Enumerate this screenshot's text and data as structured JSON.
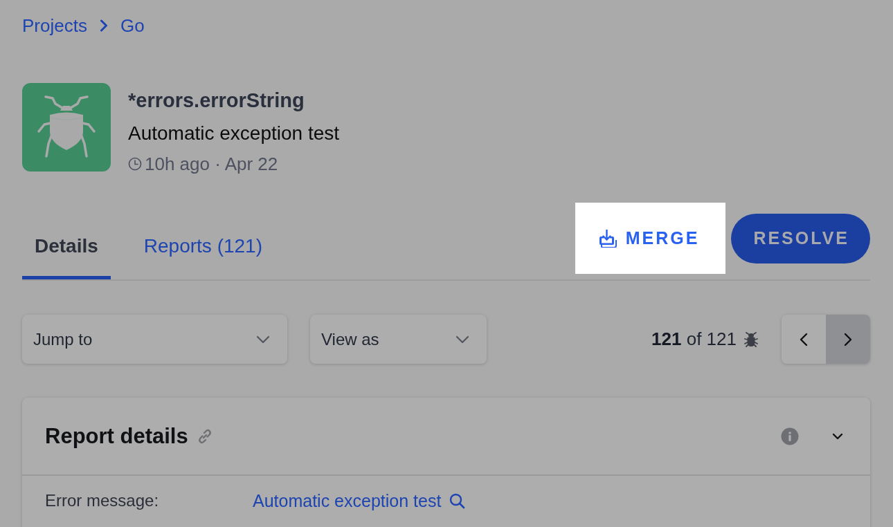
{
  "breadcrumb": [
    {
      "label": "Projects"
    },
    {
      "label": "Go"
    }
  ],
  "issue": {
    "title": "*errors.errorString",
    "message": "Automatic exception test",
    "time": "10h ago · Apr 22"
  },
  "tabs": [
    {
      "label": "Details",
      "selected": true
    },
    {
      "label": "Reports (121)",
      "selected": false
    }
  ],
  "actions": [
    {
      "kind": "merge",
      "label": "MERGE",
      "highlighted": true
    },
    {
      "kind": "resolve",
      "label": "RESOLVE",
      "highlighted": false
    }
  ],
  "dropdowns": [
    {
      "placeholder": "Jump to"
    },
    {
      "placeholder": "View as"
    }
  ],
  "counter": "**121** of 121",
  "pager": [
    {
      "kind": "previous",
      "highlighted": false
    },
    {
      "kind": "next",
      "highlighted": true
    }
  ],
  "card": {
    "title": "Report details",
    "expanded": true,
    "fields": [
      {
        "label": "Error message:",
        "value": "Automatic exception test"
      }
    ]
  }
}
